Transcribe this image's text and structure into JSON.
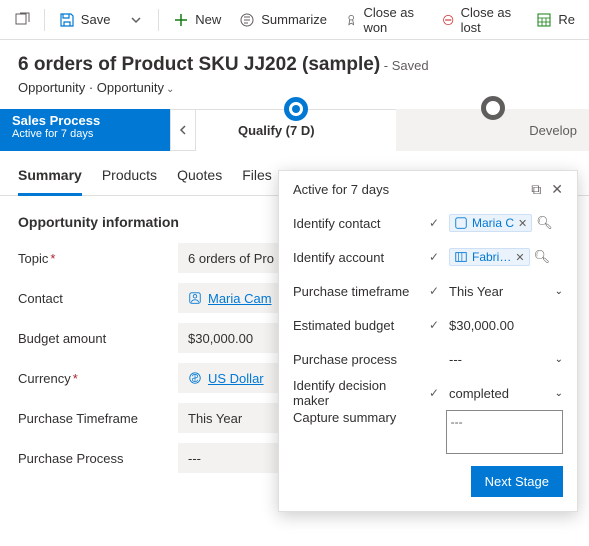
{
  "toolbar": {
    "save": "Save",
    "new": "New",
    "summarize": "Summarize",
    "close_won": "Close as won",
    "close_lost": "Close as lost",
    "rec": "Re"
  },
  "header": {
    "title": "6 orders of Product SKU JJ202 (sample)",
    "saved": "- Saved",
    "crumb1": "Opportunity",
    "crumb2": "Opportunity"
  },
  "stages": {
    "current_name": "Sales Process",
    "current_sub": "Active for 7 days",
    "qualify": "Qualify  (7 D)",
    "develop": "Develop"
  },
  "tabs": [
    "Summary",
    "Products",
    "Quotes",
    "Files"
  ],
  "section": "Opportunity information",
  "form": {
    "topic_label": "Topic",
    "topic_val": "6 orders of Pro",
    "contact_label": "Contact",
    "contact_val": "Maria Cam",
    "budget_label": "Budget amount",
    "budget_val": "$30,000.00",
    "currency_label": "Currency",
    "currency_val": "US Dollar",
    "ptf_label": "Purchase Timeframe",
    "ptf_val": "This Year",
    "pp_label": "Purchase Process",
    "pp_val": "---"
  },
  "flyout": {
    "active": "Active for 7 days",
    "rows": {
      "id_contact": "Identify contact",
      "id_contact_val": "Maria C",
      "id_account": "Identify account",
      "id_account_val": "Fabri…",
      "ptf": "Purchase timeframe",
      "ptf_val": "This Year",
      "budget": "Estimated budget",
      "budget_val": "$30,000.00",
      "process": "Purchase process",
      "process_val": "---",
      "idm": "Identify decision maker",
      "idm_val": "completed",
      "capture": "Capture summary",
      "capture_val": "---"
    },
    "next": "Next Stage"
  }
}
